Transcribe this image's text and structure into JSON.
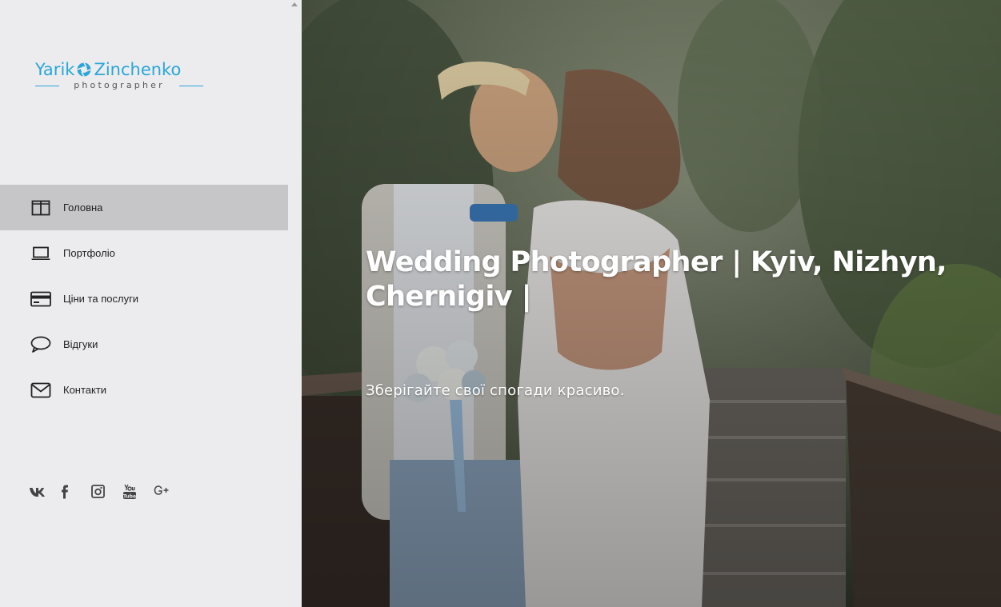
{
  "brand": {
    "name_part1": "Yarik",
    "name_part2": "Zinchenko",
    "tagline": "photographer",
    "accent_color": "#2aa6d8"
  },
  "nav": {
    "items": [
      {
        "label": "Головна",
        "icon": "columns-icon",
        "active": true
      },
      {
        "label": "Портфоліо",
        "icon": "laptop-icon",
        "active": false
      },
      {
        "label": "Ціни та послуги",
        "icon": "credit-card-icon",
        "active": false
      },
      {
        "label": "Відгуки",
        "icon": "speech-bubble-icon",
        "active": false
      },
      {
        "label": "Контакти",
        "icon": "envelope-icon",
        "active": false
      }
    ]
  },
  "social": {
    "items": [
      {
        "icon": "vk-icon"
      },
      {
        "icon": "facebook-icon"
      },
      {
        "icon": "instagram-icon"
      },
      {
        "icon": "youtube-icon"
      },
      {
        "icon": "google-plus-icon"
      }
    ]
  },
  "hero": {
    "title": "Wedding Photographer | Kyiv, Nizhyn, Chernigiv |",
    "subtitle": "Зберігайте свої спогади красиво."
  }
}
